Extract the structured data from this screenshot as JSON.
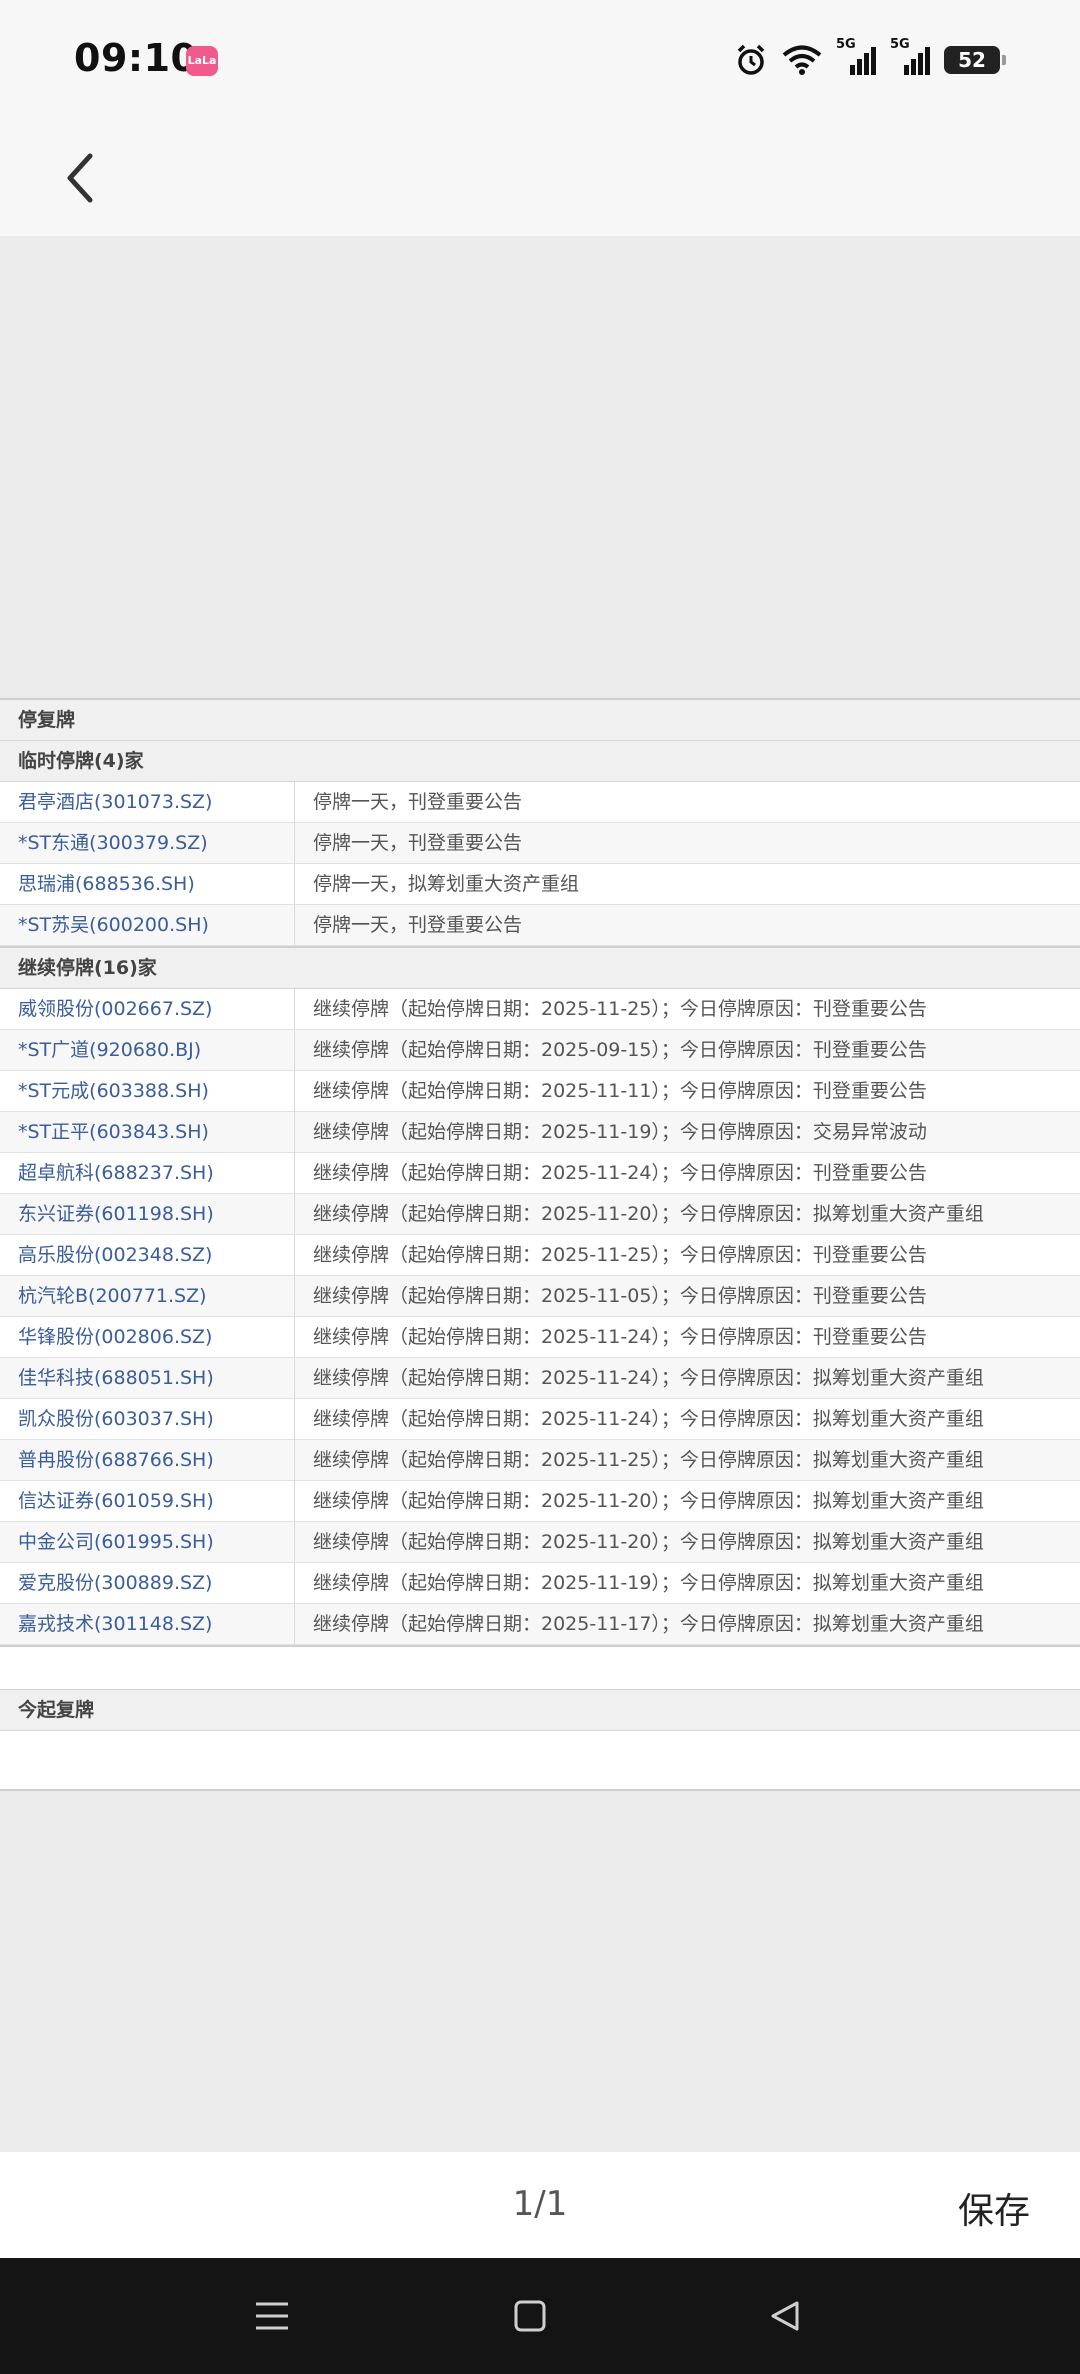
{
  "status_bar": {
    "time": "09:10",
    "app_badge": "LaLa",
    "battery": "52",
    "signal_label_1": "5G",
    "signal_label_2": "5G"
  },
  "header": {
    "back_icon": "chevron-left-icon"
  },
  "document": {
    "title": "停复牌",
    "temporary": {
      "heading": "临时停牌(4)家",
      "rows": [
        {
          "name": "君亭酒店(301073.SZ)",
          "reason": "停牌一天，刊登重要公告"
        },
        {
          "name": "*ST东通(300379.SZ)",
          "reason": "停牌一天，刊登重要公告"
        },
        {
          "name": "思瑞浦(688536.SH)",
          "reason": "停牌一天，拟筹划重大资产重组"
        },
        {
          "name": "*ST苏吴(600200.SH)",
          "reason": "停牌一天，刊登重要公告"
        }
      ]
    },
    "continued": {
      "heading": "继续停牌(16)家",
      "rows": [
        {
          "name": "威领股份(002667.SZ)",
          "reason": "继续停牌（起始停牌日期：2025-11-25）；今日停牌原因：刊登重要公告"
        },
        {
          "name": "*ST广道(920680.BJ)",
          "reason": "继续停牌（起始停牌日期：2025-09-15）；今日停牌原因：刊登重要公告"
        },
        {
          "name": "*ST元成(603388.SH)",
          "reason": "继续停牌（起始停牌日期：2025-11-11）；今日停牌原因：刊登重要公告"
        },
        {
          "name": "*ST正平(603843.SH)",
          "reason": "继续停牌（起始停牌日期：2025-11-19）；今日停牌原因：交易异常波动"
        },
        {
          "name": "超卓航科(688237.SH)",
          "reason": "继续停牌（起始停牌日期：2025-11-24）；今日停牌原因：刊登重要公告"
        },
        {
          "name": "东兴证券(601198.SH)",
          "reason": "继续停牌（起始停牌日期：2025-11-20）；今日停牌原因：拟筹划重大资产重组"
        },
        {
          "name": "高乐股份(002348.SZ)",
          "reason": "继续停牌（起始停牌日期：2025-11-25）；今日停牌原因：刊登重要公告"
        },
        {
          "name": "杭汽轮B(200771.SZ)",
          "reason": "继续停牌（起始停牌日期：2025-11-05）；今日停牌原因：刊登重要公告"
        },
        {
          "name": "华锋股份(002806.SZ)",
          "reason": "继续停牌（起始停牌日期：2025-11-24）；今日停牌原因：刊登重要公告"
        },
        {
          "name": "佳华科技(688051.SH)",
          "reason": "继续停牌（起始停牌日期：2025-11-24）；今日停牌原因：拟筹划重大资产重组"
        },
        {
          "name": "凯众股份(603037.SH)",
          "reason": "继续停牌（起始停牌日期：2025-11-24）；今日停牌原因：拟筹划重大资产重组"
        },
        {
          "name": "普冉股份(688766.SH)",
          "reason": "继续停牌（起始停牌日期：2025-11-25）；今日停牌原因：拟筹划重大资产重组"
        },
        {
          "name": "信达证券(601059.SH)",
          "reason": "继续停牌（起始停牌日期：2025-11-20）；今日停牌原因：拟筹划重大资产重组"
        },
        {
          "name": "中金公司(601995.SH)",
          "reason": "继续停牌（起始停牌日期：2025-11-20）；今日停牌原因：拟筹划重大资产重组"
        },
        {
          "name": "爱克股份(300889.SZ)",
          "reason": "继续停牌（起始停牌日期：2025-11-19）；今日停牌原因：拟筹划重大资产重组"
        },
        {
          "name": "嘉戎技术(301148.SZ)",
          "reason": "继续停牌（起始停牌日期：2025-11-17）；今日停牌原因：拟筹划重大资产重组"
        }
      ]
    },
    "resume": {
      "heading": "今起复牌"
    }
  },
  "bottom_bar": {
    "page_indicator": "1/1",
    "save_label": "保存"
  },
  "navbar": {
    "menu_icon": "menu-icon",
    "home_icon": "home-square-icon",
    "back_icon": "back-triangle-icon"
  }
}
